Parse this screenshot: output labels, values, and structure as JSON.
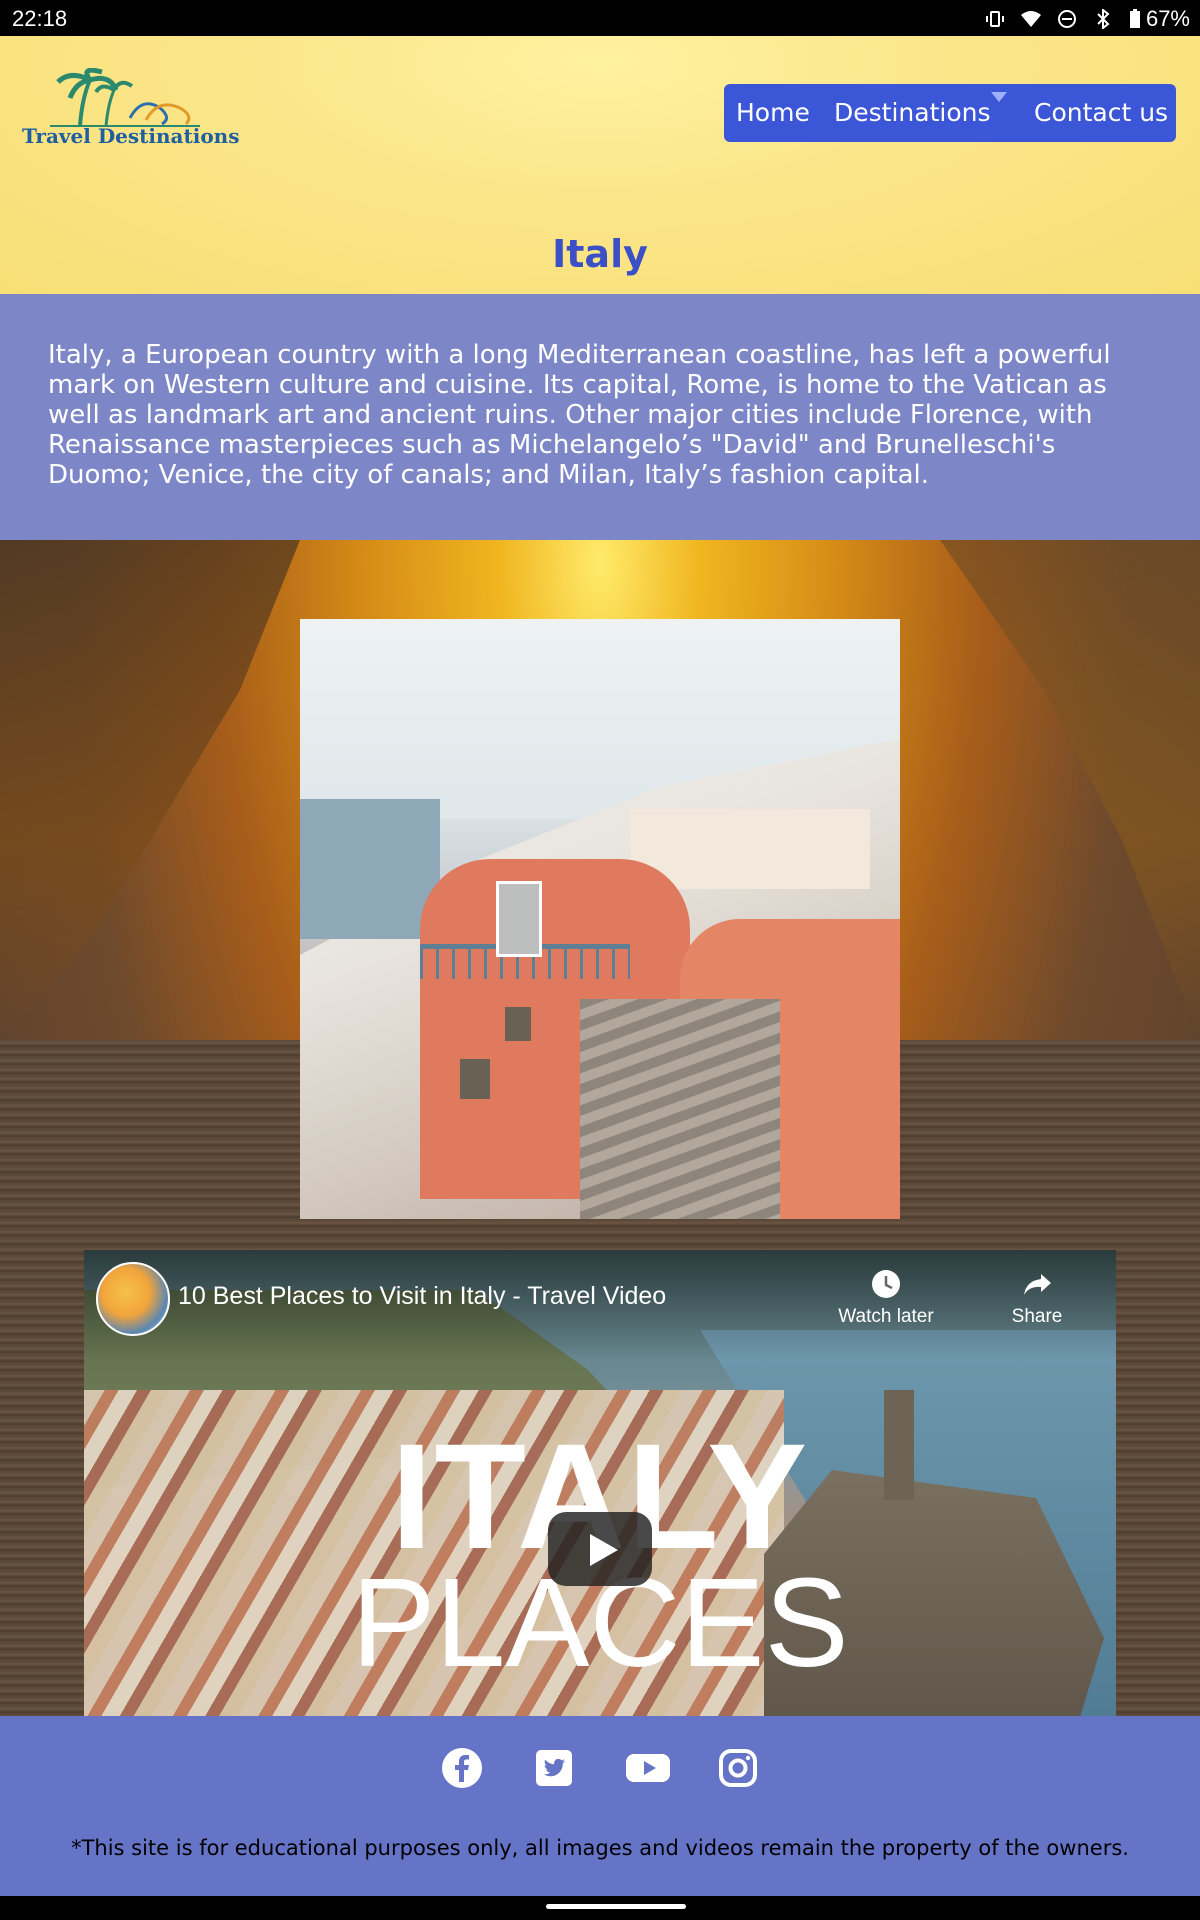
{
  "status_bar": {
    "time": "22:18",
    "battery": "67%",
    "icons": [
      "vibrate-icon",
      "wifi-icon",
      "do-not-disturb-icon",
      "bluetooth-icon",
      "battery-icon"
    ]
  },
  "header": {
    "logo_text": "Travel Destinations",
    "nav": {
      "home": "Home",
      "destinations": "Destinations",
      "contact": "Contact us"
    },
    "accent_color": "#3c56d8"
  },
  "page": {
    "title": "Italy",
    "intro": "Italy, a European country with a long Mediterranean coastline, has left a powerful mark on Western culture and cuisine. Its capital, Rome, is home to the Vatican as well as landmark art and ancient ruins. Other major cities include Florence, with Renaissance masterpieces such as Michelangelo’s \"David\" and Brunelleschi's Duomo; Venice, the city of canals; and Milan, Italy’s fashion capital."
  },
  "video": {
    "title": "10 Best Places to Visit in Italy - Travel Video",
    "watch_later": "Watch later",
    "share": "Share",
    "overlay_line1": "ITALY",
    "overlay_line2": "PLACES"
  },
  "footer": {
    "social_icons": [
      "facebook-icon",
      "twitter-icon",
      "youtube-icon",
      "instagram-icon"
    ],
    "note": "*This site is for educational purposes only, all images and videos remain the property of the owners."
  }
}
